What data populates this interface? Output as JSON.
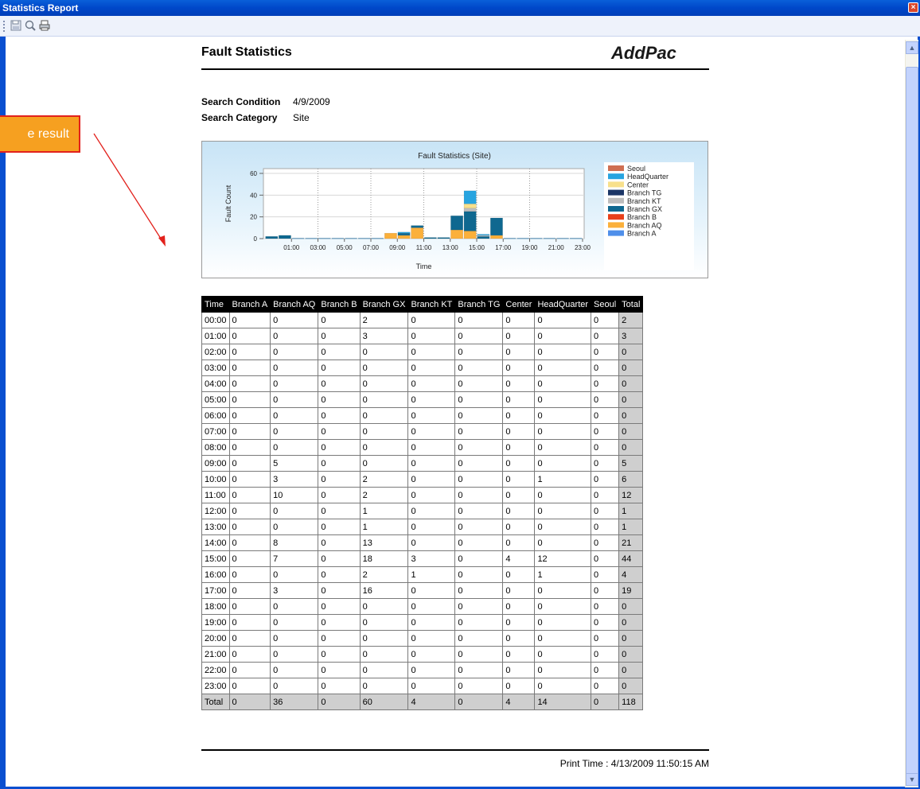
{
  "window": {
    "title": "Statistics Report",
    "close_glyph": "×"
  },
  "toolbar": {
    "items": [
      {
        "icon": "save-icon"
      },
      {
        "icon": "zoom-icon"
      },
      {
        "icon": "print-icon"
      }
    ]
  },
  "callout": {
    "text": "e result"
  },
  "report": {
    "title": "Fault Statistics",
    "brand": "AddPac",
    "search_condition_label": "Search Condition",
    "search_condition_value": "4/9/2009",
    "search_category_label": "Search Category",
    "search_category_value": "Site",
    "print_time": "Print Time : 4/13/2009 11:50:15 AM"
  },
  "chart_data": {
    "type": "bar",
    "stacked": true,
    "title": "Fault Statistics (Site)",
    "xlabel": "Time",
    "ylabel": "Fault Count",
    "ylim": [
      0,
      60
    ],
    "yticks": [
      0,
      20,
      40,
      60
    ],
    "categories": [
      "00:00",
      "01:00",
      "02:00",
      "03:00",
      "04:00",
      "05:00",
      "06:00",
      "07:00",
      "08:00",
      "09:00",
      "10:00",
      "11:00",
      "12:00",
      "13:00",
      "14:00",
      "15:00",
      "16:00",
      "17:00",
      "18:00",
      "19:00",
      "20:00",
      "21:00",
      "22:00",
      "23:00"
    ],
    "xtick_labels": [
      "01:00",
      "03:00",
      "05:00",
      "07:00",
      "09:00",
      "11:00",
      "13:00",
      "15:00",
      "17:00",
      "19:00",
      "21:00",
      "23:00"
    ],
    "legend_position": "right",
    "series": [
      {
        "name": "Branch A",
        "color": "#4f8fea",
        "values": [
          0,
          0,
          0,
          0,
          0,
          0,
          0,
          0,
          0,
          0,
          0,
          0,
          0,
          0,
          0,
          0,
          0,
          0,
          0,
          0,
          0,
          0,
          0,
          0
        ]
      },
      {
        "name": "Branch AQ",
        "color": "#fbb03b",
        "values": [
          0,
          0,
          0,
          0,
          0,
          0,
          0,
          0,
          0,
          5,
          3,
          10,
          0,
          0,
          8,
          7,
          0,
          3,
          0,
          0,
          0,
          0,
          0,
          0
        ]
      },
      {
        "name": "Branch B",
        "color": "#e8401a",
        "values": [
          0,
          0,
          0,
          0,
          0,
          0,
          0,
          0,
          0,
          0,
          0,
          0,
          0,
          0,
          0,
          0,
          0,
          0,
          0,
          0,
          0,
          0,
          0,
          0
        ]
      },
      {
        "name": "Branch GX",
        "color": "#0f6890",
        "values": [
          2,
          3,
          0,
          0,
          0,
          0,
          0,
          0,
          0,
          0,
          2,
          2,
          1,
          1,
          13,
          18,
          2,
          16,
          0,
          0,
          0,
          0,
          0,
          0
        ]
      },
      {
        "name": "Branch KT",
        "color": "#bdbdbd",
        "values": [
          0,
          0,
          0,
          0,
          0,
          0,
          0,
          0,
          0,
          0,
          0,
          0,
          0,
          0,
          0,
          3,
          1,
          0,
          0,
          0,
          0,
          0,
          0,
          0
        ]
      },
      {
        "name": "Branch TG",
        "color": "#1b3566",
        "values": [
          0,
          0,
          0,
          0,
          0,
          0,
          0,
          0,
          0,
          0,
          0,
          0,
          0,
          0,
          0,
          0,
          0,
          0,
          0,
          0,
          0,
          0,
          0,
          0
        ]
      },
      {
        "name": "Center",
        "color": "#f8e08c",
        "values": [
          0,
          0,
          0,
          0,
          0,
          0,
          0,
          0,
          0,
          0,
          0,
          0,
          0,
          0,
          0,
          4,
          0,
          0,
          0,
          0,
          0,
          0,
          0,
          0
        ]
      },
      {
        "name": "HeadQuarter",
        "color": "#27a4e0",
        "values": [
          0,
          0,
          0,
          0,
          0,
          0,
          0,
          0,
          0,
          0,
          1,
          0,
          0,
          0,
          0,
          12,
          1,
          0,
          0,
          0,
          0,
          0,
          0,
          0
        ]
      },
      {
        "name": "Seoul",
        "color": "#cf6f52",
        "values": [
          0,
          0,
          0,
          0,
          0,
          0,
          0,
          0,
          0,
          0,
          0,
          0,
          0,
          0,
          0,
          0,
          0,
          0,
          0,
          0,
          0,
          0,
          0,
          0
        ]
      }
    ],
    "legend_order": [
      "Seoul",
      "HeadQuarter",
      "Center",
      "Branch TG",
      "Branch KT",
      "Branch GX",
      "Branch B",
      "Branch AQ",
      "Branch A"
    ]
  },
  "table": {
    "headers": [
      "Time",
      "Branch A",
      "Branch AQ",
      "Branch B",
      "Branch GX",
      "Branch KT",
      "Branch TG",
      "Center",
      "HeadQuarter",
      "Seoul",
      "Total"
    ],
    "rows": [
      [
        "00:00",
        "0",
        "0",
        "0",
        "2",
        "0",
        "0",
        "0",
        "0",
        "0",
        "2"
      ],
      [
        "01:00",
        "0",
        "0",
        "0",
        "3",
        "0",
        "0",
        "0",
        "0",
        "0",
        "3"
      ],
      [
        "02:00",
        "0",
        "0",
        "0",
        "0",
        "0",
        "0",
        "0",
        "0",
        "0",
        "0"
      ],
      [
        "03:00",
        "0",
        "0",
        "0",
        "0",
        "0",
        "0",
        "0",
        "0",
        "0",
        "0"
      ],
      [
        "04:00",
        "0",
        "0",
        "0",
        "0",
        "0",
        "0",
        "0",
        "0",
        "0",
        "0"
      ],
      [
        "05:00",
        "0",
        "0",
        "0",
        "0",
        "0",
        "0",
        "0",
        "0",
        "0",
        "0"
      ],
      [
        "06:00",
        "0",
        "0",
        "0",
        "0",
        "0",
        "0",
        "0",
        "0",
        "0",
        "0"
      ],
      [
        "07:00",
        "0",
        "0",
        "0",
        "0",
        "0",
        "0",
        "0",
        "0",
        "0",
        "0"
      ],
      [
        "08:00",
        "0",
        "0",
        "0",
        "0",
        "0",
        "0",
        "0",
        "0",
        "0",
        "0"
      ],
      [
        "09:00",
        "0",
        "5",
        "0",
        "0",
        "0",
        "0",
        "0",
        "0",
        "0",
        "5"
      ],
      [
        "10:00",
        "0",
        "3",
        "0",
        "2",
        "0",
        "0",
        "0",
        "1",
        "0",
        "6"
      ],
      [
        "11:00",
        "0",
        "10",
        "0",
        "2",
        "0",
        "0",
        "0",
        "0",
        "0",
        "12"
      ],
      [
        "12:00",
        "0",
        "0",
        "0",
        "1",
        "0",
        "0",
        "0",
        "0",
        "0",
        "1"
      ],
      [
        "13:00",
        "0",
        "0",
        "0",
        "1",
        "0",
        "0",
        "0",
        "0",
        "0",
        "1"
      ],
      [
        "14:00",
        "0",
        "8",
        "0",
        "13",
        "0",
        "0",
        "0",
        "0",
        "0",
        "21"
      ],
      [
        "15:00",
        "0",
        "7",
        "0",
        "18",
        "3",
        "0",
        "4",
        "12",
        "0",
        "44"
      ],
      [
        "16:00",
        "0",
        "0",
        "0",
        "2",
        "1",
        "0",
        "0",
        "1",
        "0",
        "4"
      ],
      [
        "17:00",
        "0",
        "3",
        "0",
        "16",
        "0",
        "0",
        "0",
        "0",
        "0",
        "19"
      ],
      [
        "18:00",
        "0",
        "0",
        "0",
        "0",
        "0",
        "0",
        "0",
        "0",
        "0",
        "0"
      ],
      [
        "19:00",
        "0",
        "0",
        "0",
        "0",
        "0",
        "0",
        "0",
        "0",
        "0",
        "0"
      ],
      [
        "20:00",
        "0",
        "0",
        "0",
        "0",
        "0",
        "0",
        "0",
        "0",
        "0",
        "0"
      ],
      [
        "21:00",
        "0",
        "0",
        "0",
        "0",
        "0",
        "0",
        "0",
        "0",
        "0",
        "0"
      ],
      [
        "22:00",
        "0",
        "0",
        "0",
        "0",
        "0",
        "0",
        "0",
        "0",
        "0",
        "0"
      ],
      [
        "23:00",
        "0",
        "0",
        "0",
        "0",
        "0",
        "0",
        "0",
        "0",
        "0",
        "0"
      ]
    ],
    "total_row": [
      "Total",
      "0",
      "36",
      "0",
      "60",
      "4",
      "0",
      "4",
      "14",
      "0",
      "118"
    ]
  }
}
